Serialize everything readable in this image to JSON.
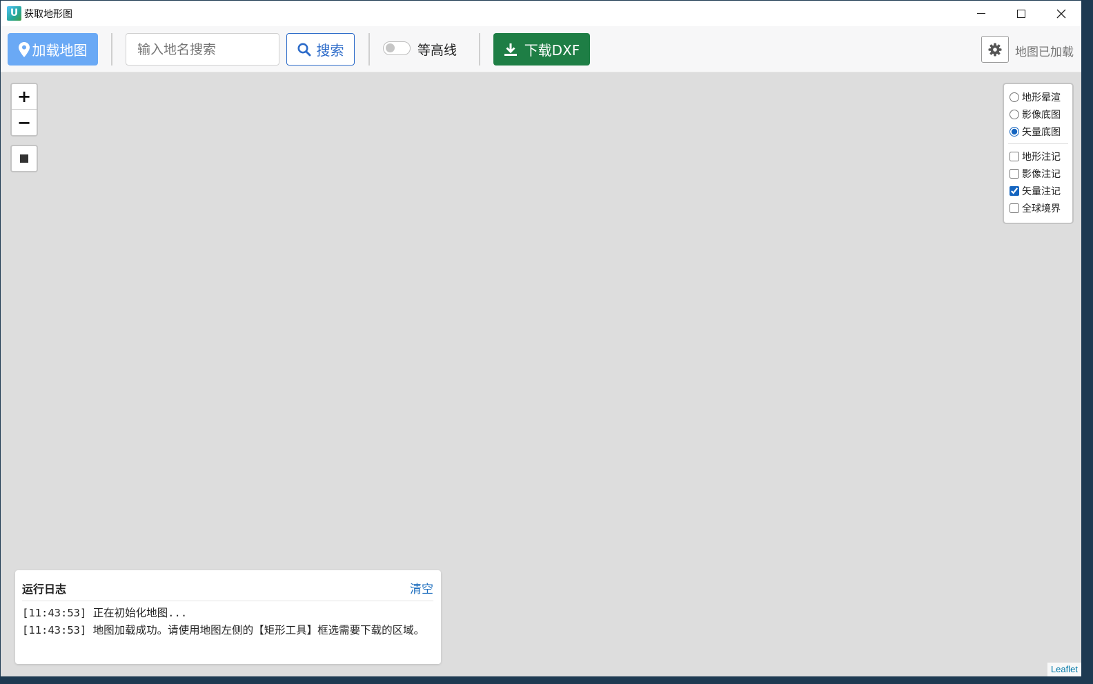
{
  "window": {
    "title": "获取地形图",
    "icon_letter": "U"
  },
  "toolbar": {
    "load_map_label": "加载地图",
    "search_placeholder": "输入地名搜索",
    "search_label": "搜索",
    "contour_label": "等高线",
    "contour_enabled": false,
    "download_label": "下载DXF",
    "status_text": "地图已加载",
    "colors": {
      "load_button": "#6aa9f5",
      "search_button": "#2c6bc9",
      "download_button": "#1e7e45"
    }
  },
  "map": {
    "zoom_in_label": "+",
    "zoom_out_label": "−",
    "basemaps": [
      {
        "label": "地形晕渲",
        "selected": false
      },
      {
        "label": "影像底图",
        "selected": false
      },
      {
        "label": "矢量底图",
        "selected": true
      }
    ],
    "overlays": [
      {
        "label": "地形注记",
        "checked": false
      },
      {
        "label": "影像注记",
        "checked": false
      },
      {
        "label": "矢量注记",
        "checked": true
      },
      {
        "label": "全球境界",
        "checked": false
      }
    ],
    "attribution": "Leaflet"
  },
  "log": {
    "title": "运行日志",
    "clear_label": "清空",
    "lines": [
      "[11:43:53] 正在初始化地图...",
      "[11:43:53] 地图加载成功。请使用地图左侧的【矩形工具】框选需要下载的区域。"
    ]
  }
}
